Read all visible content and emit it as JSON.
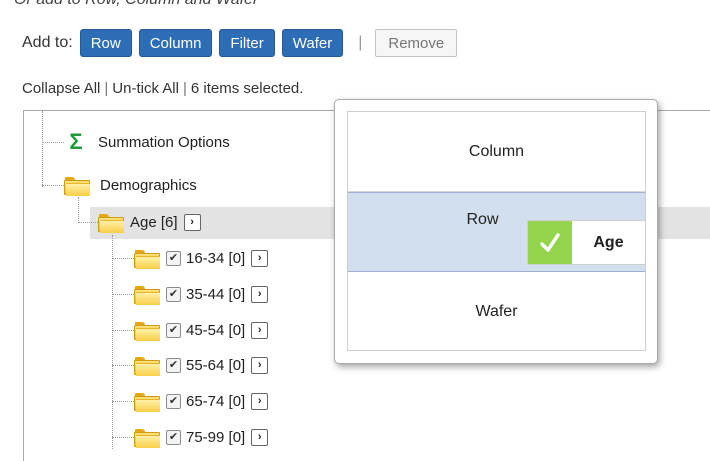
{
  "header": {
    "cut_text": "Or add to Row, Column and Wafer"
  },
  "toolbar": {
    "add_to_label": "Add to:",
    "buttons": [
      "Row",
      "Column",
      "Filter",
      "Wafer"
    ],
    "separator": "|",
    "remove_label": "Remove",
    "accent_color": "#2d6db5"
  },
  "selection": {
    "collapse_all": "Collapse All",
    "untick_all": "Un-tick All",
    "pipe": "|",
    "selected_count": "6 items selected."
  },
  "tree": {
    "summation": "Summation Options",
    "demographics": "Demographics",
    "age": "Age [6]",
    "expand_glyph": "›",
    "check_glyph": "✔",
    "items": [
      "16-34 [0]",
      "35-44 [0]",
      "45-54 [0]",
      "55-64 [0]",
      "65-74 [0]",
      "75-99 [0]"
    ]
  },
  "popup": {
    "options": [
      "Column",
      "Row",
      "Wafer"
    ],
    "highlighted": "Row",
    "drag_chip_label": "Age",
    "drag_chip_color": "#93d44c"
  }
}
